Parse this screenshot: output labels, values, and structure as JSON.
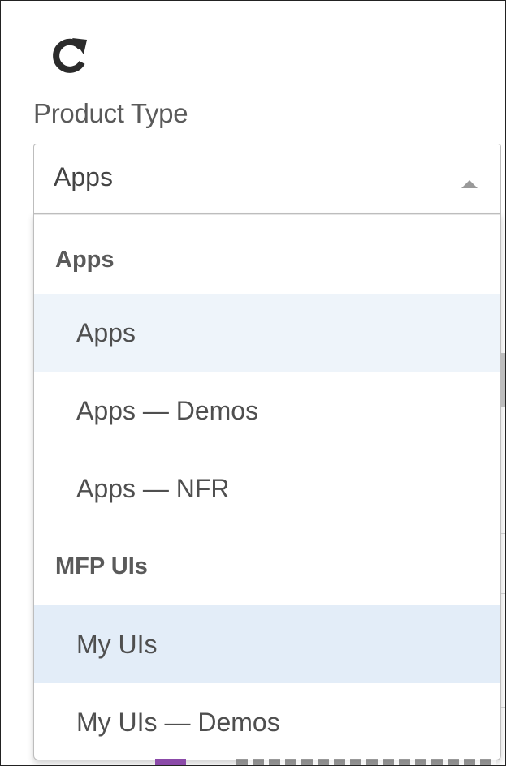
{
  "filter": {
    "label": "Product Type",
    "selected_value": "Apps"
  },
  "dropdown": {
    "groups": [
      {
        "header": "Apps",
        "options": [
          "Apps",
          "Apps — Demos",
          "Apps — NFR"
        ]
      },
      {
        "header": "MFP UIs",
        "options": [
          "My UIs",
          "My UIs — Demos"
        ]
      }
    ]
  },
  "icons": {
    "refresh": "refresh-icon",
    "caret": "caret-up-icon"
  },
  "colors": {
    "highlight": "#eef4fa",
    "selected": "#e3edf8",
    "text": "#4f4f4f"
  }
}
